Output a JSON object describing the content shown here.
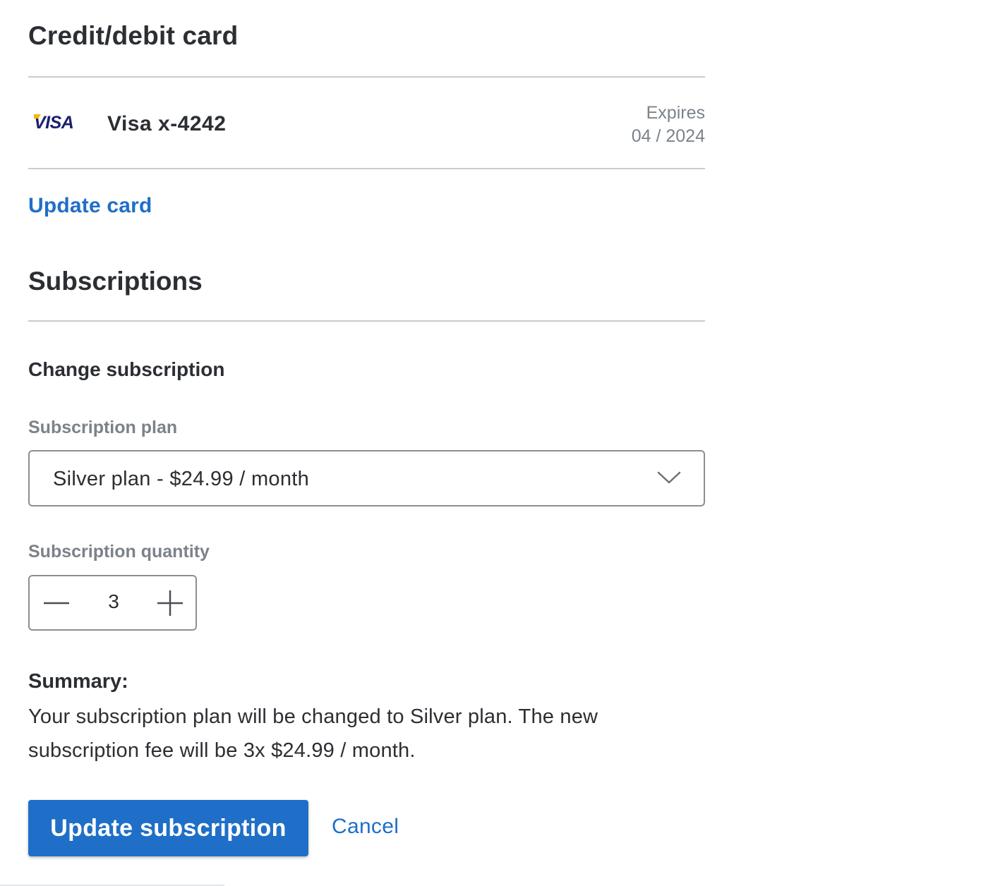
{
  "card_section": {
    "title": "Credit/debit card",
    "brand_logo": "VISA",
    "card_label": "Visa x-4242",
    "expires_label": "Expires",
    "expires_value": "04 / 2024",
    "update_link": "Update card"
  },
  "subscriptions_section": {
    "title": "Subscriptions",
    "change_title": "Change subscription",
    "plan_label": "Subscription plan",
    "plan_selected": "Silver plan - $24.99 / month",
    "quantity_label": "Subscription quantity",
    "quantity_value": "3",
    "summary_title": "Summary:",
    "summary_text": "Your subscription plan will be changed to Silver plan. The new subscription fee will be 3x $24.99 / month.",
    "update_button": "Update subscription",
    "cancel_link": "Cancel"
  },
  "icons": {
    "card_brand": "visa-icon",
    "select_caret": "chevron-down-icon",
    "decrement": "minus-icon",
    "increment": "plus-icon"
  },
  "colors": {
    "accent": "#1f6fc8",
    "heading": "#2b2e33",
    "muted": "#7c828a",
    "divider": "#c8cbd0",
    "visa_blue": "#1a1f71",
    "visa_gold": "#f7b600"
  }
}
